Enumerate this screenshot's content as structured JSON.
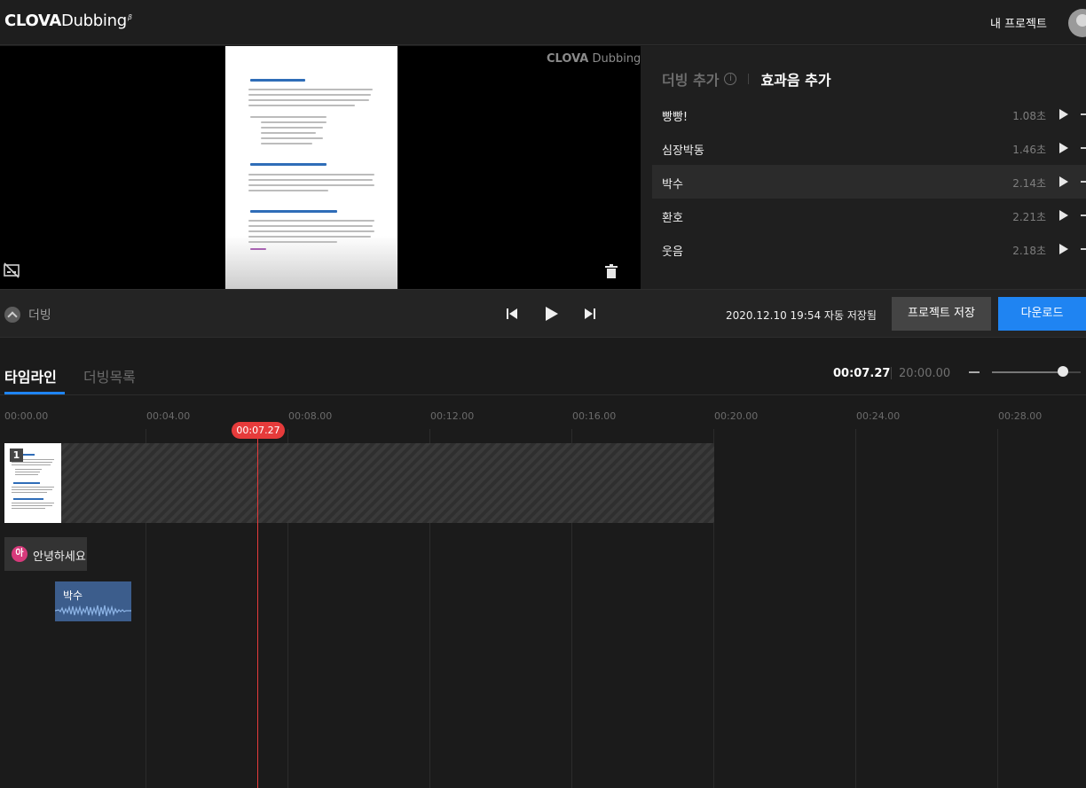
{
  "app": {
    "logo_main": "CLOVA",
    "logo_sub": "Dubbing",
    "logo_beta": "β",
    "my_projects": "내 프로젝트"
  },
  "preview": {
    "watermark_main": "CLOVA",
    "watermark_sub": "Dubbing",
    "icons": [
      "subtitle-off-icon",
      "trash-icon"
    ]
  },
  "panel": {
    "tab_dubbing": "더빙 추가",
    "tab_sfx": "효과음 추가",
    "sfx": [
      {
        "name": "빵빵!",
        "duration": "1.08초"
      },
      {
        "name": "심장박동",
        "duration": "1.46초"
      },
      {
        "name": "박수",
        "duration": "2.14초"
      },
      {
        "name": "환호",
        "duration": "2.21초"
      },
      {
        "name": "웃음",
        "duration": "2.18초"
      }
    ],
    "selected_index": 2
  },
  "controls": {
    "collapse_label": "더빙",
    "autosave": "2020.12.10 19:54 자동 저장됨",
    "save_button": "프로젝트 저장",
    "download_button": "다운로드",
    "icons": [
      "skip-back-icon",
      "play-icon",
      "skip-forward-icon"
    ]
  },
  "timeline": {
    "tab_timeline": "타임라인",
    "tab_dub_list": "더빙목록",
    "current_time": "00:07.27",
    "total_time": "20:00.00",
    "zoom_level": 0.8,
    "ticks": [
      "00:00.00",
      "00:04.00",
      "00:08.00",
      "00:12.00",
      "00:16.00",
      "00:20.00",
      "00:24.00",
      "00:28.00"
    ],
    "video_clip_number": "1",
    "dub_clip_avatar": "아",
    "dub_clip_text": "안녕하세요",
    "sfx_clip_label": "박수",
    "playhead_label": "00:07.27"
  },
  "colors": {
    "accent": "#1f84f2",
    "playhead": "#e63b3b",
    "sfx_clip": "#3c5d8c",
    "dub_avatar": "#d73a7b"
  }
}
